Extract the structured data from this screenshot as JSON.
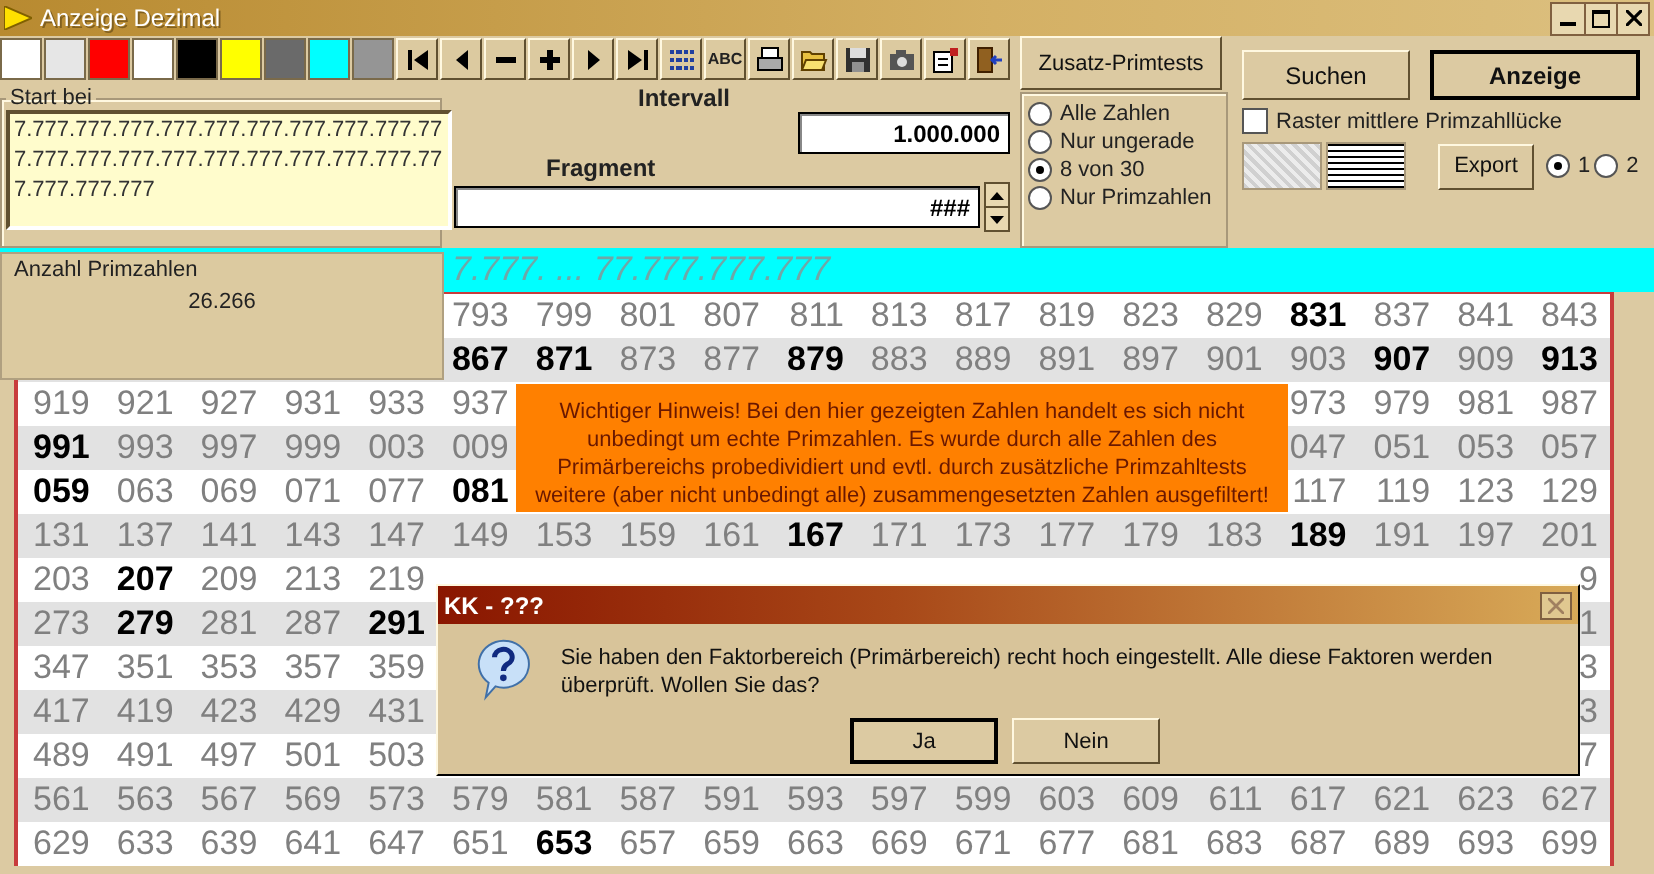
{
  "window": {
    "title": "Anzeige Dezimal"
  },
  "swatches": [
    {
      "color": "#ffffff"
    },
    {
      "color": "#e6e6e6"
    },
    {
      "color": "#ff0000"
    },
    {
      "color": "#ffffff"
    },
    {
      "color": "#000000"
    },
    {
      "color": "#ffff00"
    },
    {
      "color": "#6a6a6a"
    },
    {
      "color": "#00ffff"
    },
    {
      "color": "#959595"
    }
  ],
  "toolbar_buttons": [
    {
      "kind": "first"
    },
    {
      "kind": "prev"
    },
    {
      "kind": "minus"
    },
    {
      "kind": "plus"
    },
    {
      "kind": "next"
    },
    {
      "kind": "last"
    },
    {
      "kind": "list"
    },
    {
      "kind": "text",
      "label": "ABC"
    },
    {
      "kind": "print"
    },
    {
      "kind": "open"
    },
    {
      "kind": "save"
    },
    {
      "kind": "camera"
    },
    {
      "kind": "properties"
    },
    {
      "kind": "exit"
    }
  ],
  "extra_tests_button": "Zusatz-Primtests",
  "start": {
    "label": "Start bei",
    "value": "7.777.777.777.777.777.777.777.777.777.777.777.777.777.777.777.777.777.777.777.777.777.777.777"
  },
  "interval": {
    "label": "Intervall",
    "value": "1.000.000"
  },
  "fragment": {
    "label": "Fragment",
    "value": "###"
  },
  "filter_options": [
    {
      "label": "Alle Zahlen",
      "selected": false
    },
    {
      "label": "Nur ungerade",
      "selected": false
    },
    {
      "label": "8 von 30",
      "selected": true
    },
    {
      "label": "Nur Primzahlen",
      "selected": false
    }
  ],
  "search_button": "Suchen",
  "show_button": "Anzeige",
  "grid_option": {
    "label": "Raster mittlere Primzahllücke",
    "checked": false
  },
  "export_button": "Export",
  "export_options": [
    {
      "label": "1",
      "selected": true
    },
    {
      "label": "2",
      "selected": false
    }
  ],
  "range_bar": "7.777. ... 77.777.777.777",
  "count": {
    "label": "Anzahl Primzahlen",
    "value": "26.266"
  },
  "rows": [
    {
      "cells": [
        null,
        null,
        null,
        null,
        null,
        {
          "text": "793",
          "bold": false
        },
        {
          "text": "799",
          "bold": false
        },
        {
          "text": "801",
          "bold": false
        },
        {
          "text": "807",
          "bold": false
        },
        {
          "text": "811",
          "bold": false
        },
        {
          "text": "813",
          "bold": false
        },
        {
          "text": "817",
          "bold": false
        },
        {
          "text": "819",
          "bold": false
        },
        {
          "text": "823",
          "bold": false
        },
        {
          "text": "829",
          "bold": false
        },
        {
          "text": "831",
          "bold": true
        },
        {
          "text": "837",
          "bold": false
        },
        {
          "text": "841",
          "bold": false
        },
        {
          "text": "843",
          "bold": false
        }
      ]
    },
    {
      "cells": [
        null,
        null,
        null,
        null,
        null,
        {
          "text": "867",
          "bold": true
        },
        {
          "text": "871",
          "bold": true
        },
        {
          "text": "873",
          "bold": false
        },
        {
          "text": "877",
          "bold": false
        },
        {
          "text": "879",
          "bold": true
        },
        {
          "text": "883",
          "bold": false
        },
        {
          "text": "889",
          "bold": false
        },
        {
          "text": "891",
          "bold": false
        },
        {
          "text": "897",
          "bold": false
        },
        {
          "text": "901",
          "bold": false
        },
        {
          "text": "903",
          "bold": false
        },
        {
          "text": "907",
          "bold": true
        },
        {
          "text": "909",
          "bold": false
        },
        {
          "text": "913",
          "bold": true
        }
      ]
    },
    {
      "cells": [
        {
          "text": "919",
          "bold": false
        },
        {
          "text": "921",
          "bold": false
        },
        {
          "text": "927",
          "bold": false
        },
        {
          "text": "931",
          "bold": false
        },
        {
          "text": "933",
          "bold": false
        },
        {
          "text": "937",
          "bold": false
        },
        null,
        null,
        null,
        null,
        null,
        null,
        null,
        null,
        null,
        {
          "text": "973",
          "bold": false
        },
        {
          "text": "979",
          "bold": false
        },
        {
          "text": "981",
          "bold": false
        },
        {
          "text": "987",
          "bold": false
        }
      ]
    },
    {
      "cells": [
        {
          "text": "991",
          "bold": true
        },
        {
          "text": "993",
          "bold": false
        },
        {
          "text": "997",
          "bold": false
        },
        {
          "text": "999",
          "bold": false
        },
        {
          "text": "003",
          "bold": false
        },
        {
          "text": "009",
          "bold": false
        },
        null,
        null,
        null,
        null,
        null,
        null,
        null,
        null,
        null,
        {
          "text": "047",
          "bold": false
        },
        {
          "text": "051",
          "bold": false
        },
        {
          "text": "053",
          "bold": false
        },
        {
          "text": "057",
          "bold": false
        }
      ]
    },
    {
      "cells": [
        {
          "text": "059",
          "bold": true
        },
        {
          "text": "063",
          "bold": false
        },
        {
          "text": "069",
          "bold": false
        },
        {
          "text": "071",
          "bold": false
        },
        {
          "text": "077",
          "bold": false
        },
        {
          "text": "081",
          "bold": true
        },
        null,
        null,
        null,
        null,
        null,
        null,
        null,
        null,
        null,
        {
          "text": "117",
          "bold": false
        },
        {
          "text": "119",
          "bold": false
        },
        {
          "text": "123",
          "bold": false
        },
        {
          "text": "129",
          "bold": false
        }
      ]
    },
    {
      "cells": [
        {
          "text": "131",
          "bold": false
        },
        {
          "text": "137",
          "bold": false
        },
        {
          "text": "141",
          "bold": false
        },
        {
          "text": "143",
          "bold": false
        },
        {
          "text": "147",
          "bold": false
        },
        {
          "text": "149",
          "bold": false
        },
        {
          "text": "153",
          "bold": false
        },
        {
          "text": "159",
          "bold": false
        },
        {
          "text": "161",
          "bold": false
        },
        {
          "text": "167",
          "bold": true
        },
        {
          "text": "171",
          "bold": false
        },
        {
          "text": "173",
          "bold": false
        },
        {
          "text": "177",
          "bold": false
        },
        {
          "text": "179",
          "bold": false
        },
        {
          "text": "183",
          "bold": false
        },
        {
          "text": "189",
          "bold": true
        },
        {
          "text": "191",
          "bold": false
        },
        {
          "text": "197",
          "bold": false
        },
        {
          "text": "201",
          "bold": false
        }
      ]
    },
    {
      "cells": [
        {
          "text": "203",
          "bold": false
        },
        {
          "text": "207",
          "bold": true
        },
        {
          "text": "209",
          "bold": false
        },
        {
          "text": "213",
          "bold": false
        },
        {
          "text": "219",
          "bold": false
        },
        null,
        null,
        null,
        null,
        null,
        null,
        null,
        null,
        null,
        null,
        null,
        null,
        null,
        {
          "text": "9",
          "bold": false
        }
      ]
    },
    {
      "cells": [
        {
          "text": "273",
          "bold": false
        },
        {
          "text": "279",
          "bold": true
        },
        {
          "text": "281",
          "bold": false
        },
        {
          "text": "287",
          "bold": false
        },
        {
          "text": "291",
          "bold": true
        },
        null,
        null,
        null,
        null,
        null,
        null,
        null,
        null,
        null,
        null,
        null,
        null,
        null,
        {
          "text": "1",
          "bold": false
        }
      ]
    },
    {
      "cells": [
        {
          "text": "347",
          "bold": false
        },
        {
          "text": "351",
          "bold": false
        },
        {
          "text": "353",
          "bold": false
        },
        {
          "text": "357",
          "bold": false
        },
        {
          "text": "359",
          "bold": false
        },
        null,
        null,
        null,
        null,
        null,
        null,
        null,
        null,
        null,
        null,
        null,
        null,
        null,
        {
          "text": "3",
          "bold": false
        }
      ]
    },
    {
      "cells": [
        {
          "text": "417",
          "bold": false
        },
        {
          "text": "419",
          "bold": false
        },
        {
          "text": "423",
          "bold": false
        },
        {
          "text": "429",
          "bold": false
        },
        {
          "text": "431",
          "bold": false
        },
        null,
        null,
        null,
        null,
        null,
        null,
        null,
        null,
        null,
        null,
        null,
        null,
        null,
        {
          "text": "3",
          "bold": false
        }
      ]
    },
    {
      "cells": [
        {
          "text": "489",
          "bold": false
        },
        {
          "text": "491",
          "bold": false
        },
        {
          "text": "497",
          "bold": false
        },
        {
          "text": "501",
          "bold": false
        },
        {
          "text": "503",
          "bold": false
        },
        null,
        null,
        null,
        null,
        null,
        null,
        null,
        null,
        null,
        null,
        null,
        null,
        null,
        {
          "text": "7",
          "bold": false
        }
      ]
    },
    {
      "cells": [
        {
          "text": "561",
          "bold": false
        },
        {
          "text": "563",
          "bold": false
        },
        {
          "text": "567",
          "bold": false
        },
        {
          "text": "569",
          "bold": false
        },
        {
          "text": "573",
          "bold": false
        },
        {
          "text": "579",
          "bold": false
        },
        {
          "text": "581",
          "bold": false
        },
        {
          "text": "587",
          "bold": false
        },
        {
          "text": "591",
          "bold": false
        },
        {
          "text": "593",
          "bold": false
        },
        {
          "text": "597",
          "bold": false
        },
        {
          "text": "599",
          "bold": false
        },
        {
          "text": "603",
          "bold": false
        },
        {
          "text": "609",
          "bold": false
        },
        {
          "text": "611",
          "bold": false
        },
        {
          "text": "617",
          "bold": false
        },
        {
          "text": "621",
          "bold": false
        },
        {
          "text": "623",
          "bold": false
        },
        {
          "text": "627",
          "bold": false
        }
      ]
    },
    {
      "cells": [
        {
          "text": "629",
          "bold": false
        },
        {
          "text": "633",
          "bold": false
        },
        {
          "text": "639",
          "bold": false
        },
        {
          "text": "641",
          "bold": false
        },
        {
          "text": "647",
          "bold": false
        },
        {
          "text": "651",
          "bold": false
        },
        {
          "text": "653",
          "bold": true
        },
        {
          "text": "657",
          "bold": false
        },
        {
          "text": "659",
          "bold": false
        },
        {
          "text": "663",
          "bold": false
        },
        {
          "text": "669",
          "bold": false
        },
        {
          "text": "671",
          "bold": false
        },
        {
          "text": "677",
          "bold": false
        },
        {
          "text": "681",
          "bold": false
        },
        {
          "text": "683",
          "bold": false
        },
        {
          "text": "687",
          "bold": false
        },
        {
          "text": "689",
          "bold": false
        },
        {
          "text": "693",
          "bold": false
        },
        {
          "text": "699",
          "bold": false
        }
      ]
    }
  ],
  "notice": "Wichtiger Hinweis! Bei den hier gezeigten Zahlen handelt es sich nicht unbedingt um echte Primzahlen. Es wurde durch alle Zahlen des Primärbereichs probedividiert und evtl. durch zusätzliche Primzahltests weitere (aber nicht unbedingt alle) zusammengesetzten Zahlen ausgefiltert!",
  "dialog": {
    "title": "KK - ???",
    "message": "Sie haben den Faktorbereich (Primärbereich) recht hoch eingestellt. Alle diese Faktoren werden überprüft. Wollen Sie das?",
    "buttons": [
      {
        "label": "Ja",
        "default": true
      },
      {
        "label": "Nein",
        "default": false
      }
    ]
  }
}
